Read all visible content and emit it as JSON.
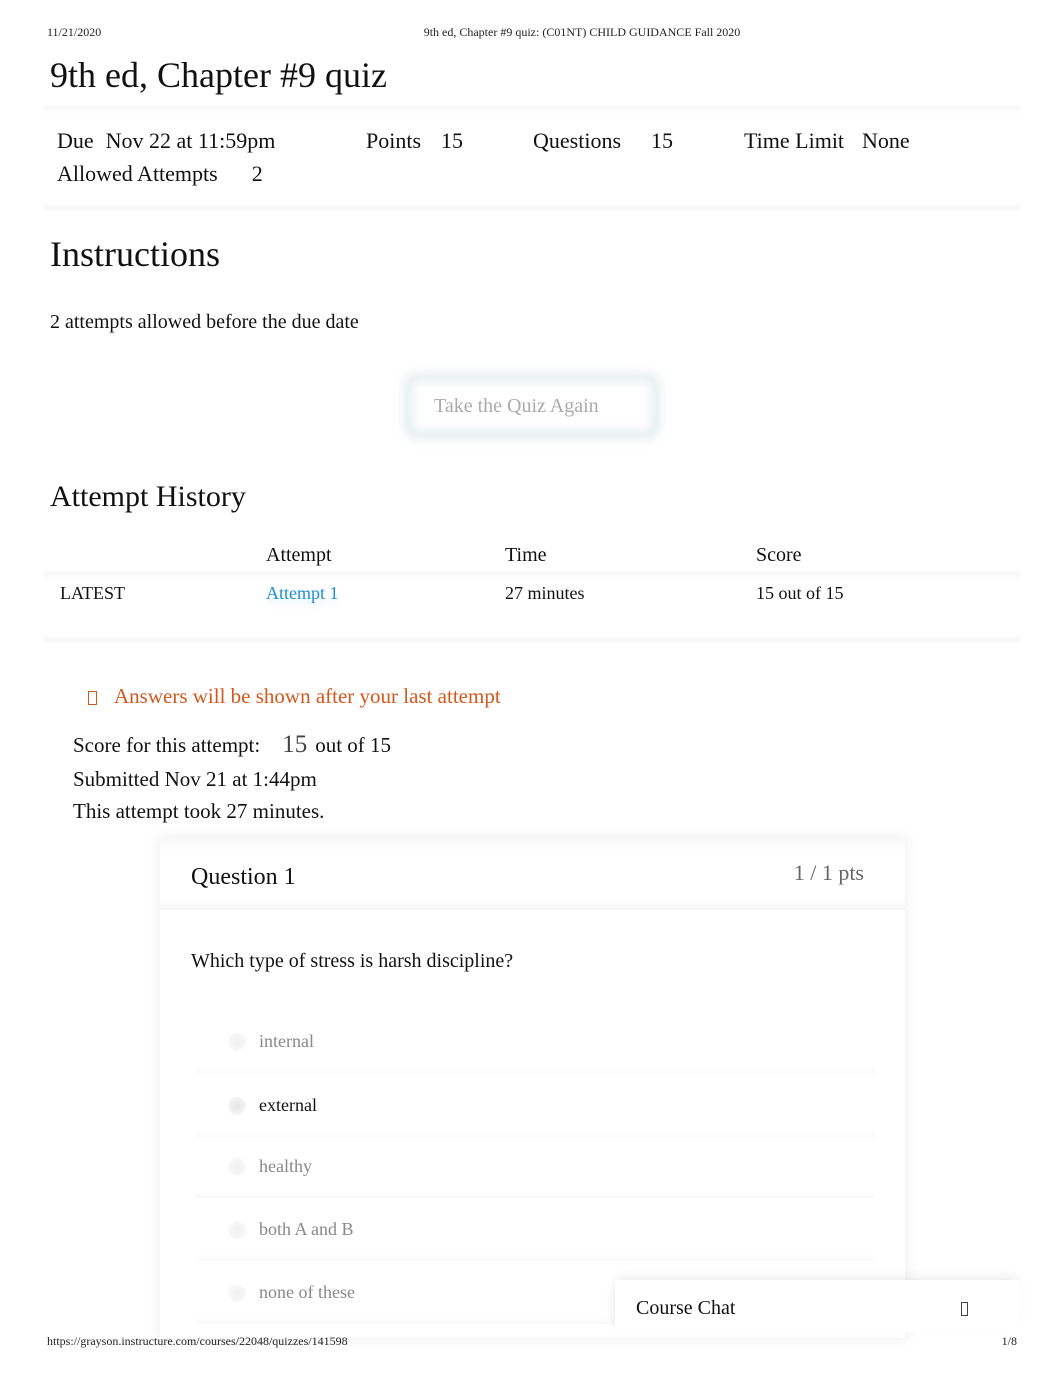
{
  "print_header": {
    "date": "11/21/2020",
    "title": "9th ed, Chapter #9 quiz: (C01NT) CHILD GUIDANCE Fall 2020"
  },
  "page_title": "9th ed, Chapter #9 quiz",
  "quiz_meta": {
    "due_label": "Due",
    "due_value": "Nov 22 at 11:59pm",
    "points_label": "Points",
    "points_value": "15",
    "questions_label": "Questions",
    "questions_value": "15",
    "time_limit_label": "Time Limit",
    "time_limit_value": "None",
    "allowed_attempts_label": "Allowed Attempts",
    "allowed_attempts_value": "2"
  },
  "instructions": {
    "heading": "Instructions",
    "text": "2 attempts allowed before the due date"
  },
  "retake_button_label": "Take the Quiz Again",
  "attempt_history": {
    "heading": "Attempt History",
    "columns": [
      "",
      "Attempt",
      "Time",
      "Score"
    ],
    "rows": [
      {
        "tag": "LATEST",
        "attempt": "Attempt 1",
        "time": "27 minutes",
        "score": "15 out of 15"
      }
    ]
  },
  "notice": {
    "icon": "info-icon",
    "text": "Answers will be shown after your last attempt",
    "color": "#d2581d"
  },
  "attempt_summary": {
    "score_label": "Score for this attempt:",
    "score_value": "15",
    "score_suffix": "out of 15",
    "submitted": "Submitted Nov 21 at 1:44pm",
    "duration": "This attempt took 27 minutes."
  },
  "questions": [
    {
      "title": "Question 1",
      "points": "1 / 1 pts",
      "text": "Which type of stress is harsh discipline?",
      "answers": [
        {
          "label": "internal",
          "selected": false
        },
        {
          "label": "external",
          "selected": true
        },
        {
          "label": "healthy",
          "selected": false
        },
        {
          "label": "both A and B",
          "selected": false
        },
        {
          "label": "none of these",
          "selected": false
        }
      ]
    }
  ],
  "course_chat": {
    "label": "Course Chat",
    "toggle_icon": "chevron-up-icon"
  },
  "print_footer": {
    "url": "https://grayson.instructure.com/courses/22048/quizzes/141598",
    "page": "1/8"
  },
  "colors": {
    "link": "#1d8ed6",
    "notice": "#d2581d"
  }
}
